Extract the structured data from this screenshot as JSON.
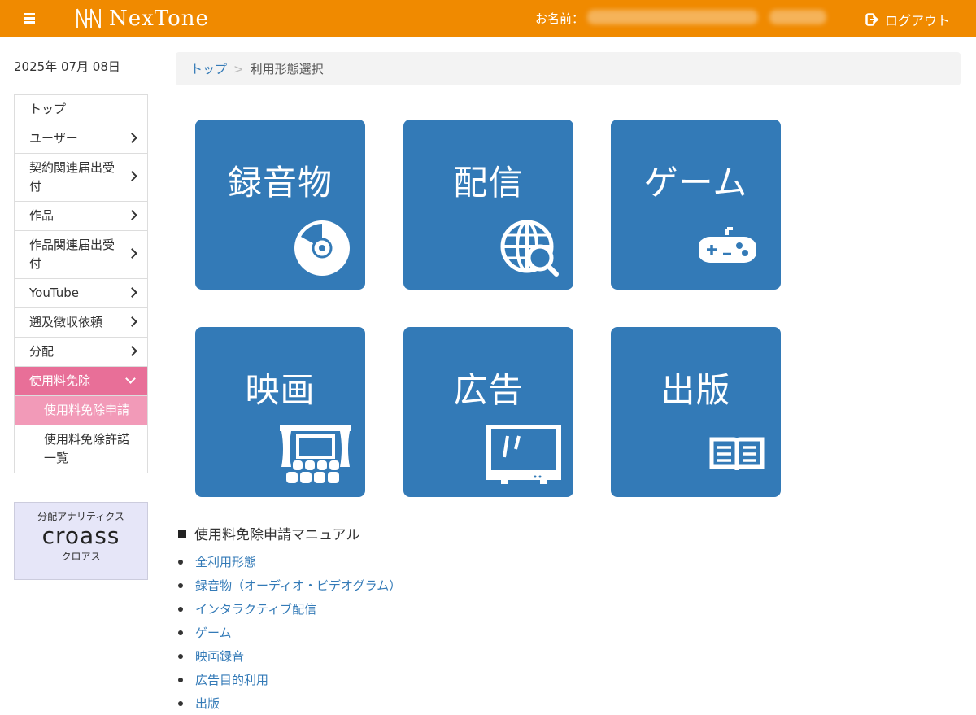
{
  "header": {
    "logo_text": "NexTone",
    "user_label": "お名前：",
    "logout_label": "ログアウト"
  },
  "sidebar": {
    "date": "2025年 07月 08日",
    "items": [
      {
        "label": "トップ"
      },
      {
        "label": "ユーザー"
      },
      {
        "label": "契約関連届出受付"
      },
      {
        "label": "作品"
      },
      {
        "label": "作品関連届出受付"
      },
      {
        "label": "YouTube"
      },
      {
        "label": "遡及徴収依頼"
      },
      {
        "label": "分配"
      },
      {
        "label": "使用料免除"
      }
    ],
    "sub_items": [
      {
        "label": "使用料免除申請"
      },
      {
        "label": "使用料免除許諾一覧"
      }
    ],
    "banner": {
      "top": "分配アナリティクス",
      "logo": "croass",
      "sub": "クロアス"
    }
  },
  "breadcrumb": {
    "home": "トップ",
    "separator": ">",
    "current": "利用形態選択"
  },
  "tiles": [
    {
      "label": "録音物",
      "icon": "cd-icon"
    },
    {
      "label": "配信",
      "icon": "globe-search-icon"
    },
    {
      "label": "ゲーム",
      "icon": "gamepad-icon"
    },
    {
      "label": "映画",
      "icon": "theater-icon"
    },
    {
      "label": "広告",
      "icon": "tv-icon"
    },
    {
      "label": "出版",
      "icon": "book-icon"
    }
  ],
  "manual": {
    "title": "使用料免除申請マニュアル",
    "links": [
      "全利用形態",
      "録音物（オーディオ・ビデオグラム）",
      "インタラクティブ配信",
      "ゲーム",
      "映画録音",
      "広告目的利用",
      "出版"
    ]
  },
  "colors": {
    "header": "#f08a00",
    "tile": "#337ab7",
    "nav_active": "#e86f98",
    "nav_sub_active": "#f29ab8",
    "link": "#337ab7"
  }
}
